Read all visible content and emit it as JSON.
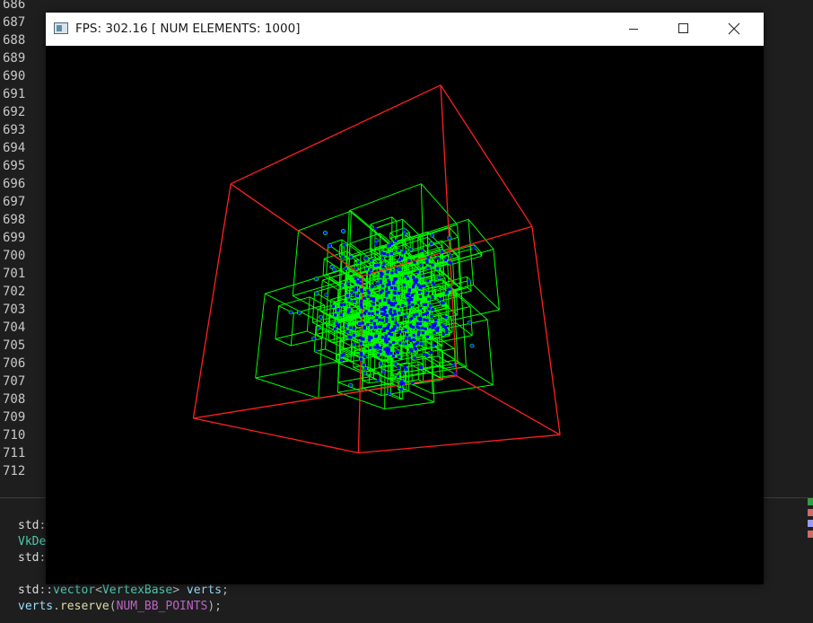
{
  "editor": {
    "line_numbers": [
      "686",
      "687",
      "688",
      "689",
      "690",
      "691",
      "692",
      "693",
      "694",
      "695",
      "696",
      "697",
      "698",
      "699",
      "700",
      "701",
      "702",
      "703",
      "704",
      "705",
      "706",
      "707",
      "708",
      "709",
      "710",
      "711",
      "712"
    ],
    "code_lines": [
      [
        {
          "t": "std",
          "c": "ns"
        },
        {
          "t": "::",
          "c": "punct"
        }
      ],
      [
        {
          "t": "VkDe",
          "c": "type"
        }
      ],
      [
        {
          "t": "std",
          "c": "ns"
        },
        {
          "t": ":",
          "c": "punct"
        }
      ],
      [],
      [
        {
          "t": "std",
          "c": "ns"
        },
        {
          "t": "::",
          "c": "punct"
        },
        {
          "t": "vector",
          "c": "type"
        },
        {
          "t": "<",
          "c": "punct"
        },
        {
          "t": "VertexBase",
          "c": "type"
        },
        {
          "t": "> ",
          "c": "punct"
        },
        {
          "t": "verts",
          "c": "var"
        },
        {
          "t": ";",
          "c": "punct"
        }
      ],
      [
        {
          "t": "verts",
          "c": "var"
        },
        {
          "t": ".",
          "c": "punct"
        },
        {
          "t": "reserve",
          "c": "fn"
        },
        {
          "t": "(",
          "c": "punct"
        },
        {
          "t": "NUM_BB_POINTS",
          "c": "macro"
        },
        {
          "t": ");",
          "c": "punct"
        }
      ]
    ],
    "minimap_colors": [
      "#2ea043",
      "#d16969",
      "#9b9bff",
      "#d16969"
    ]
  },
  "window": {
    "title": "FPS: 302.16 [ NUM ELEMENTS: 1000]",
    "icon": "app-window-icon",
    "buttons": {
      "minimize": "minimize-icon",
      "maximize": "maximize-icon",
      "close": "close-icon"
    }
  },
  "scene": {
    "description_kind": "octree-bounding-boxes",
    "num_elements": 1000,
    "colors": {
      "background": "#000000",
      "root_box": "#ff2020",
      "child_boxes": "#00ff00",
      "points": "#0000ff"
    }
  }
}
